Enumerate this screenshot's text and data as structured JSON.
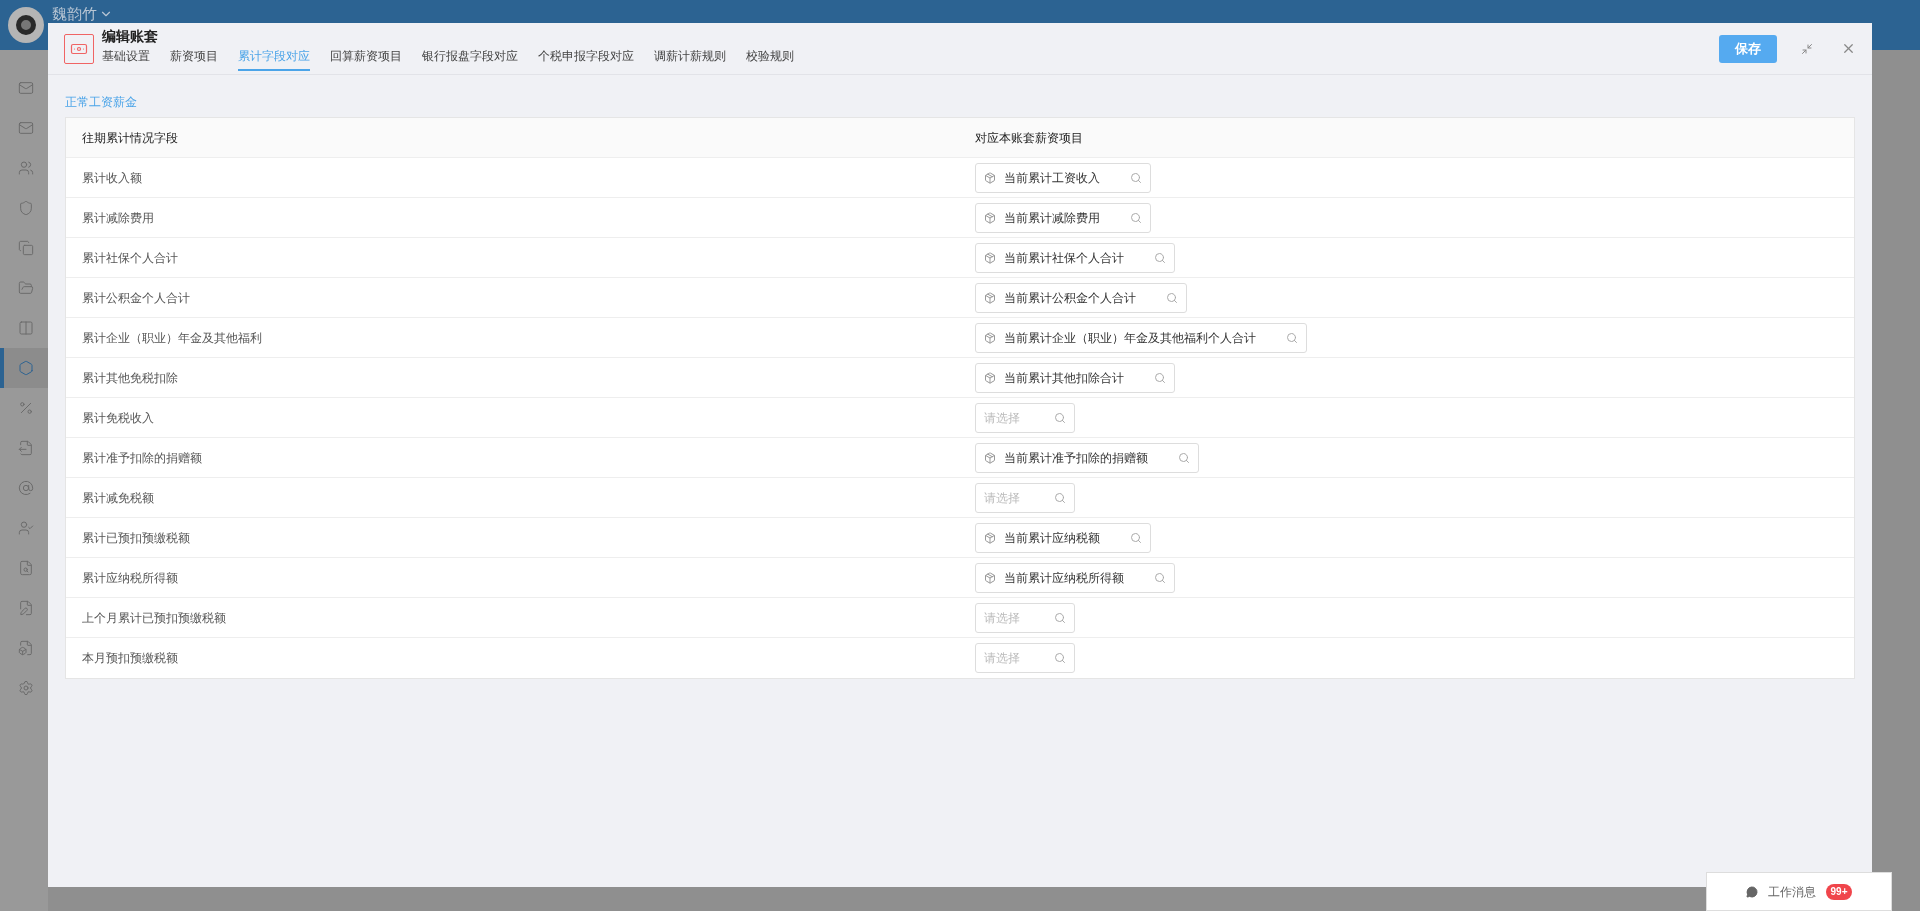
{
  "user": {
    "name": "魏韵竹"
  },
  "sidebar": {
    "items": [
      {
        "selected": false
      },
      {
        "selected": false
      },
      {
        "selected": false
      },
      {
        "selected": false
      },
      {
        "selected": false
      },
      {
        "selected": false
      },
      {
        "selected": false
      },
      {
        "selected": true
      },
      {
        "selected": false
      },
      {
        "selected": false
      },
      {
        "selected": false
      },
      {
        "selected": false
      },
      {
        "selected": false
      },
      {
        "selected": false
      },
      {
        "selected": false
      },
      {
        "selected": false
      }
    ]
  },
  "dialog": {
    "title": "编辑账套",
    "save_button": "保存",
    "tabs": [
      {
        "label": "基础设置",
        "selected": false
      },
      {
        "label": "薪资项目",
        "selected": false
      },
      {
        "label": "累计字段对应",
        "selected": true
      },
      {
        "label": "回算薪资项目",
        "selected": false
      },
      {
        "label": "银行报盘字段对应",
        "selected": false
      },
      {
        "label": "个税申报字段对应",
        "selected": false
      },
      {
        "label": "调薪计薪规则",
        "selected": false
      },
      {
        "label": "校验规则",
        "selected": false
      }
    ],
    "section": "正常工资薪金",
    "table": {
      "columns": [
        "往期累计情况字段",
        "对应本账套薪资项目"
      ],
      "rows": [
        {
          "field": "累计收入额",
          "mapping": {
            "value": "当前累计工资收入"
          }
        },
        {
          "field": "累计减除费用",
          "mapping": {
            "value": "当前累计减除费用"
          }
        },
        {
          "field": "累计社保个人合计",
          "mapping": {
            "value": "当前累计社保个人合计"
          }
        },
        {
          "field": "累计公积金个人合计",
          "mapping": {
            "value": "当前累计公积金个人合计"
          }
        },
        {
          "field": "累计企业（职业）年金及其他福利",
          "mapping": {
            "value": "当前累计企业（职业）年金及其他福利个人合计"
          }
        },
        {
          "field": "累计其他免税扣除",
          "mapping": {
            "value": "当前累计其他扣除合计"
          }
        },
        {
          "field": "累计免税收入",
          "mapping": {
            "placeholder": "请选择"
          }
        },
        {
          "field": "累计准予扣除的捐赠额",
          "mapping": {
            "value": "当前累计准予扣除的捐赠额"
          }
        },
        {
          "field": "累计减免税额",
          "mapping": {
            "placeholder": "请选择"
          }
        },
        {
          "field": "累计已预扣预缴税额",
          "mapping": {
            "value": "当前累计应纳税额"
          }
        },
        {
          "field": "累计应纳税所得额",
          "mapping": {
            "value": "当前累计应纳税所得额"
          }
        },
        {
          "field": "上个月累计已预扣预缴税额",
          "mapping": {
            "placeholder": "请选择"
          }
        },
        {
          "field": "本月预扣预缴税额",
          "mapping": {
            "placeholder": "请选择"
          }
        }
      ]
    }
  },
  "message_widget": {
    "label": "工作消息",
    "badge": "99+"
  }
}
